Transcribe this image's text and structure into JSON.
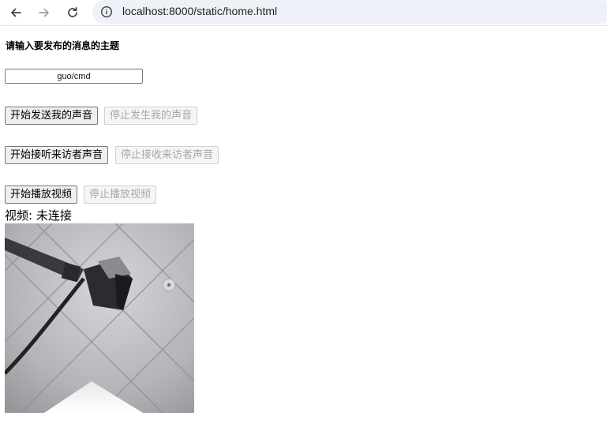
{
  "browser": {
    "url": "localhost:8000/static/home.html",
    "icons": {
      "back": "back-arrow-icon",
      "forward": "forward-arrow-icon",
      "reload": "reload-icon",
      "site_info": "info-icon"
    }
  },
  "page": {
    "prompt": "请输入要发布的消息的主题",
    "topic_value": "guo/cmd",
    "buttons": {
      "start_send_voice": "开始发送我的声音",
      "stop_send_voice": "停止发生我的声音",
      "start_listen_visitor": "开始接听来访者声音",
      "stop_listen_visitor": "停止接收来访者声音",
      "start_play_video": "开始播放视频",
      "stop_play_video": "停止播放视频"
    },
    "video_status": "视频: 未连接"
  },
  "colors": {
    "omnibox_bg": "#eef1f8",
    "button_bg": "#efefef",
    "disabled_text": "#a8a8a8"
  }
}
